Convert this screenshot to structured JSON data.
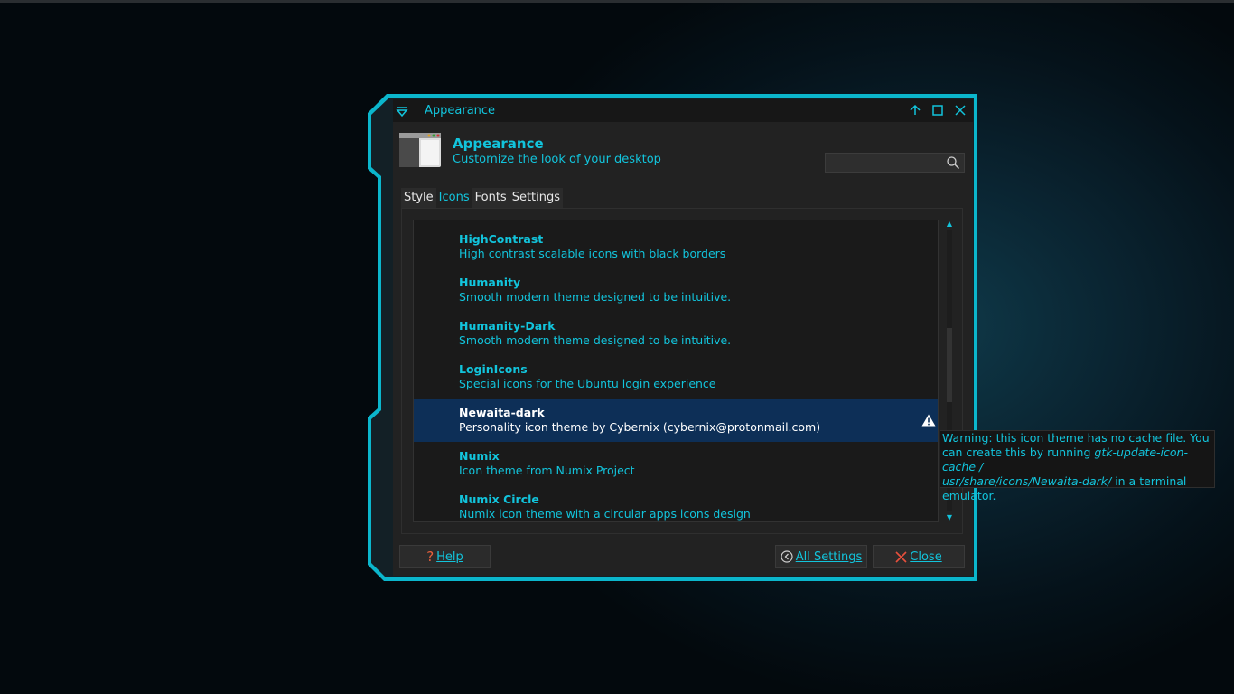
{
  "window": {
    "title": "Appearance"
  },
  "header": {
    "title": "Appearance",
    "subtitle": "Customize the look of your desktop"
  },
  "search": {
    "value": "",
    "placeholder": ""
  },
  "tabs": [
    {
      "label": "Style",
      "active": false
    },
    {
      "label": "Icons",
      "active": true
    },
    {
      "label": "Fonts",
      "active": false
    },
    {
      "label": "Settings",
      "active": false
    }
  ],
  "icon_themes": [
    {
      "name": "HighContrast",
      "description": "High contrast scalable icons with black borders",
      "selected": false
    },
    {
      "name": "Humanity",
      "description": "Smooth modern theme designed to be intuitive.",
      "selected": false
    },
    {
      "name": "Humanity-Dark",
      "description": "Smooth modern theme designed to be intuitive.",
      "selected": false
    },
    {
      "name": "LoginIcons",
      "description": "Special icons for the Ubuntu login experience",
      "selected": false
    },
    {
      "name": "Newaita-dark",
      "description": "Personality icon theme by Cybernix (cybernix@protonmail.com)",
      "selected": true,
      "warning_icon": "warning-icon"
    },
    {
      "name": "Numix",
      "description": "Icon theme from Numix Project",
      "selected": false
    },
    {
      "name": "Numix Circle",
      "description": "Numix icon theme with a circular apps icons design",
      "selected": false
    }
  ],
  "tooltip": {
    "line1": "Warning: this icon theme has no cache file. You",
    "line2_prefix": "can create this by running ",
    "line2_cmd": "gtk-update-icon-cache /",
    "line3_cmd": "usr/share/icons/Newaita-dark/",
    "line3_suffix": " in a terminal",
    "line4": "emulator."
  },
  "buttons": {
    "help": "Help",
    "all_settings": "All Settings",
    "close": "Close"
  },
  "colors": {
    "accent": "#12c4dc",
    "selection": "#0d2f57",
    "help_icon": "#e8603c",
    "close_icon": "#e8503c"
  }
}
